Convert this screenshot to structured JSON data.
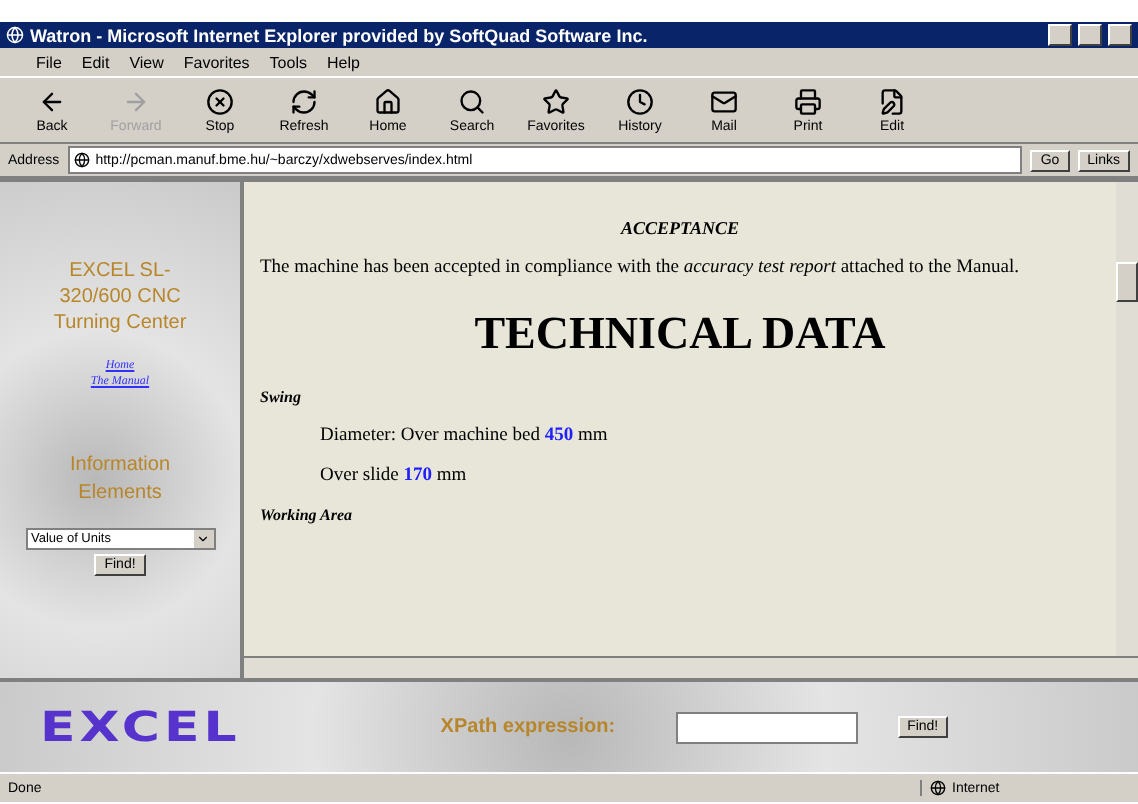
{
  "window": {
    "title": "Watron - Microsoft Internet Explorer provided by SoftQuad Software Inc."
  },
  "menu": [
    "File",
    "Edit",
    "View",
    "Favorites",
    "Tools",
    "Help"
  ],
  "toolbar": [
    {
      "kind": "back",
      "label": "Back",
      "disabled": false
    },
    {
      "kind": "forward",
      "label": "Forward",
      "disabled": true
    },
    {
      "kind": "stop",
      "label": "Stop",
      "disabled": false
    },
    {
      "kind": "refresh",
      "label": "Refresh",
      "disabled": false
    },
    {
      "kind": "home",
      "label": "Home",
      "disabled": false
    },
    {
      "kind": "search",
      "label": "Search",
      "disabled": false
    },
    {
      "kind": "favorites",
      "label": "Favorites",
      "disabled": false
    },
    {
      "kind": "history",
      "label": "History",
      "disabled": false
    },
    {
      "kind": "mail",
      "label": "Mail",
      "disabled": false
    },
    {
      "kind": "print",
      "label": "Print",
      "disabled": false
    },
    {
      "kind": "edit",
      "label": "Edit",
      "disabled": false
    }
  ],
  "address": {
    "label": "Address",
    "value": "http://pcman.manuf.bme.hu/~barczy/xdwebserves/index.html",
    "go": "Go",
    "links": "Links"
  },
  "sidebar": {
    "title": "EXCEL SL-320/600 CNC Turning Center",
    "links": [
      "Home",
      "The Manual"
    ],
    "section_title": "Information Elements",
    "select": "Value of Units",
    "button": "Find!"
  },
  "content": [
    {
      "kind": "caption",
      "text": "ACCEPTANCE"
    },
    {
      "kind": "para",
      "text": "The machine has been accepted in compliance with the *accuracy test report* attached to the Manual."
    },
    {
      "kind": "title",
      "text": "TECHNICAL DATA"
    },
    {
      "kind": "subhead",
      "text": "Swing"
    },
    {
      "kind": "indent",
      "text": "Diameter: Over machine bed **450** mm"
    },
    {
      "kind": "indent",
      "text": "Over slide **170** mm"
    },
    {
      "kind": "subhead",
      "text": "Working Area"
    }
  ],
  "bottom": {
    "logo": "EXCEL",
    "label": "XPath expression:",
    "button": "Find!"
  },
  "status": {
    "text": "Done",
    "zone": "Internet"
  }
}
